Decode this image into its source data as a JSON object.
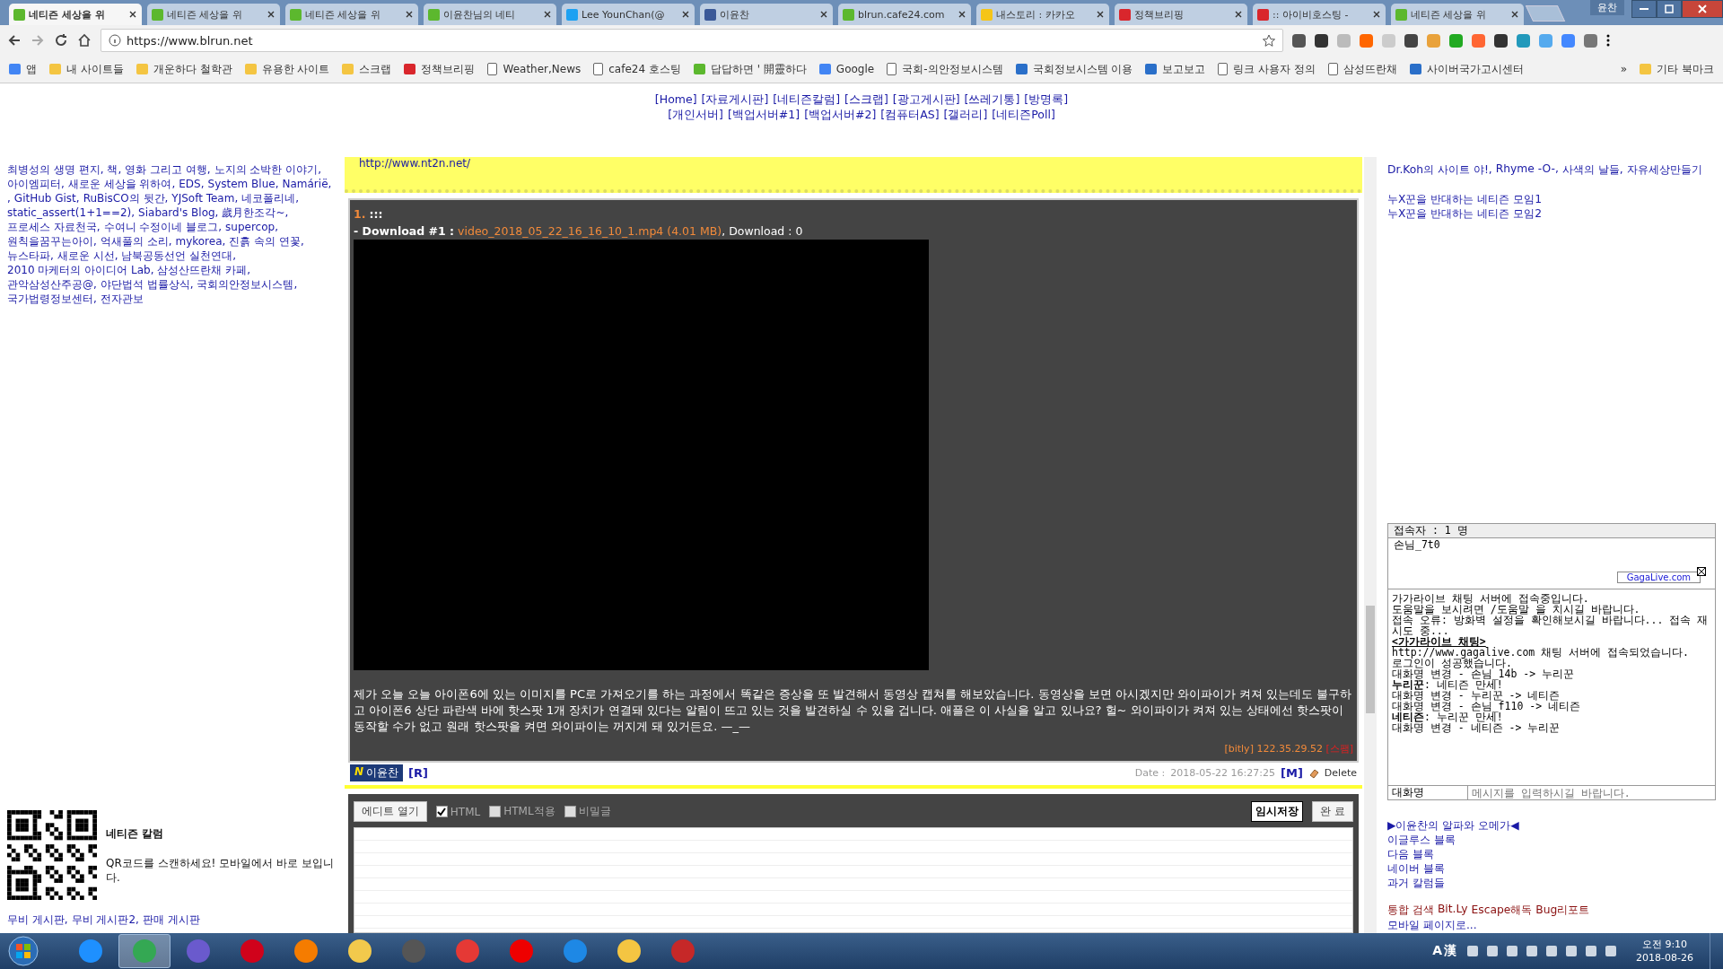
{
  "browser": {
    "user": "윤찬",
    "tabs": [
      {
        "label": "네티즌 세상을 위",
        "kind": "leaf",
        "selected": true
      },
      {
        "label": "네티즌 세상을 위",
        "kind": "leaf",
        "selected": false
      },
      {
        "label": "네티즌 세상을 위",
        "kind": "leaf",
        "selected": false
      },
      {
        "label": "이윤찬님의 네티",
        "kind": "leaf",
        "selected": false
      },
      {
        "label": "Lee YounChan(@",
        "kind": "bird",
        "selected": false
      },
      {
        "label": "이윤찬",
        "kind": "fb",
        "selected": false
      },
      {
        "label": "blrun.cafe24.com",
        "kind": "leaf",
        "selected": false
      },
      {
        "label": "내스토리 : 카카오",
        "kind": "note",
        "selected": false
      },
      {
        "label": "정책브리핑",
        "kind": "red",
        "selected": false
      },
      {
        "label": ":: 아이비호스팅 -",
        "kind": "red",
        "selected": false
      },
      {
        "label": "네티즌 세상을 위",
        "kind": "leaf",
        "selected": false
      }
    ],
    "url": "https://www.blrun.net",
    "bookmarks": [
      {
        "label": "앱",
        "kind": "apps"
      },
      {
        "label": "내 사이트들",
        "kind": "folder"
      },
      {
        "label": "개운하다 철학관",
        "kind": "folder"
      },
      {
        "label": "유용한 사이트",
        "kind": "folder"
      },
      {
        "label": "스크랩",
        "kind": "folder"
      },
      {
        "label": "정책브리핑",
        "kind": "red"
      },
      {
        "label": "Weather,News",
        "kind": "page"
      },
      {
        "label": "cafe24 호스팅",
        "kind": "page"
      },
      {
        "label": "답답하면 ' 開靈하다",
        "kind": "leaf"
      },
      {
        "label": "Google",
        "kind": "g"
      },
      {
        "label": "국회-의안정보시스템",
        "kind": "page"
      },
      {
        "label": "국회정보시스템 이용",
        "kind": "blue"
      },
      {
        "label": "보고보고",
        "kind": "blue"
      },
      {
        "label": "링크 사용자 정의",
        "kind": "page"
      },
      {
        "label": "삼성뜨란채",
        "kind": "page"
      },
      {
        "label": "사이버국가고시센터",
        "kind": "blue"
      }
    ],
    "more": "»",
    "other": "기타 북마크"
  },
  "nav": [
    [
      "[Home]",
      "[자료게시판]",
      "[네티즌칼럼]",
      "[스크랩]",
      "[광고게시판]",
      "[쓰레기통]",
      "[방명록]"
    ],
    [
      "[개인서버]",
      "[백업서버#1]",
      "[백업서버#2]",
      "[컴퓨터AS]",
      "[갤러리]",
      "[네티즌Poll]"
    ]
  ],
  "left": {
    "links": [
      "최병성의 생명 편지,",
      "책, 영화 그리고 여행,",
      "노지의 소박한 이야기,",
      "아이엠피터,",
      "새로운 세상을 위하여,",
      "EDS,",
      "System Blue,",
      "Namárië,",
      ",",
      "GitHub Gist,",
      "RuBisCO의 뒷간,",
      "YJSoft Team,",
      "네코폴리네,",
      "static_assert(1+1==2),",
      "Siabard's Blog,",
      "歲月한조각~,",
      "프로세스 자료천국,",
      "수여니 수정이네 블로그,",
      "supercop,",
      "원칙을꿈꾸는아이,",
      "억새풀의 소리,",
      "mykorea,",
      "진흙 속의 연꽃,",
      "뉴스타파,",
      "새로운 시선,",
      "남북공동선언 실천연대,",
      "2010 마케터의 아이디어 Lab,",
      "삼성산뜨란채 카페,",
      "관악삼성산주공@,",
      "야단법석 법률상식,",
      "국회의안정보시스템,",
      "국가법령정보센터,",
      "전자관보"
    ],
    "qr_title": "네티즌 칼럼",
    "qr_text": "QR코드를 스캔하세요! 모바일에서 바로 보입니다.",
    "boards": [
      "무비 게시판,",
      "무비 게시판2,",
      "판매 게시판"
    ]
  },
  "post": {
    "top_link": "http://www.nt2n.net/",
    "number": "1.",
    "title": ":::",
    "download_label": "- Download #1 :",
    "file": "video_2018_05_22_16_16_10_1.mp4 (4.01 MB)",
    "download_count": ", Download : 0",
    "body": "제가 오늘 오늘 아이폰6에 있는 이미지를 PC로 가져오기를 하는 과정에서 똑같은 증상을 또 발견해서 동영상 캡쳐를 해보았습니다. 동영상을 보면 아시겠지만 와이파이가 켜져 있는데도 불구하고 아이폰6 상단 파란색 바에 핫스팟 1개 장치가 연결돼 있다는 알림이 뜨고 있는 것을 발견하실 수 있을 겁니다. 애플은 이 사실을 알고 있나요? 헐~ 와이파이가 켜져 있는 상태에선 핫스팟이 동작할 수가 없고 원래 핫스팟을 켜면 와이파이는 꺼지게 돼 있거든요. —_—",
    "ip": "[bitly] 122.35.29.52",
    "spam": "[스팸]",
    "author_badge": "N",
    "author": "이윤찬",
    "reply": "[R]",
    "date_label": "Date :",
    "date": "2018-05-22 16:27:25",
    "modify": "[M]",
    "delete": "Delete"
  },
  "editor": {
    "open_button": "에디트 열기",
    "options": [
      {
        "label": "HTML",
        "checked": true
      },
      {
        "label": "HTML적용",
        "checked": false
      },
      {
        "label": "비밀글",
        "checked": false
      }
    ],
    "save_button": "임시저장",
    "done_button": "완 료"
  },
  "right": {
    "links": [
      "Dr.Koh의 사이트 야!,",
      "Rhyme -O-,",
      "사색의 날들,",
      "자유세상만들기"
    ],
    "groups": [
      "누X꾼을 반대하는 네티즌 모임1",
      "누X꾼을 반대하는 네티즌 모임2"
    ],
    "chat": {
      "users_header": "접속자 : 1 명",
      "users": [
        "손님_7t0"
      ],
      "brand": "GagaLive.com",
      "messages": [
        {
          "kind": "line",
          "text": "가가라이브 채팅 서버에 접속중입니다."
        },
        {
          "kind": "line",
          "text": "도움말을 보시려면 /도움말 을 치시길 바랍니다."
        },
        {
          "kind": "line",
          "text": "접속 오류: 방화벽 설정을 확인해보시길 바랍니다... 접속 재시도 중..."
        },
        {
          "kind": "header",
          "text": "<가가라이브 채팅>"
        },
        {
          "kind": "line",
          "text": "http://www.gagalive.com 채팅 서버에 접속되었습니다."
        },
        {
          "kind": "line",
          "text": "로그인이 성공했습니다."
        },
        {
          "kind": "line",
          "text": "대화명 변경 - 손님_14b -> 누리꾼"
        },
        {
          "kind": "line",
          "text": "**누리꾼**: 네티즌 만세!"
        },
        {
          "kind": "line",
          "text": "대화명 변경 - 누리꾼 -> 네티즌"
        },
        {
          "kind": "line",
          "text": "대화명 변경 - 손님_f110 -> 네티즌"
        },
        {
          "kind": "line",
          "text": "**네티즌**: 누리꾼 만세!"
        },
        {
          "kind": "line",
          "text": "대화명 변경 - 네티즌 -> 누리꾼"
        }
      ],
      "nick": "대화명",
      "placeholder": "메시지를 입력하시길 바랍니다."
    },
    "blogs": [
      "▶이윤찬의 알파와 오메가◀",
      "이글루스 블록",
      "다음 블록",
      "네이버 블록",
      "과거 칼럼들"
    ],
    "tools": [
      "통합 검색",
      "Bit.Ly",
      "Escape해독",
      "Bug리포트"
    ],
    "mobile": "모바일 페이지로..."
  },
  "taskbar": {
    "apps": [
      {
        "kind": "ie",
        "selected": false
      },
      {
        "kind": "chrome",
        "selected": true
      },
      {
        "kind": "orb",
        "selected": false
      },
      {
        "kind": "opera",
        "selected": false
      },
      {
        "kind": "firefox",
        "selected": false
      },
      {
        "kind": "winamp",
        "selected": false
      },
      {
        "kind": "drive",
        "selected": false
      },
      {
        "kind": "disc",
        "selected": false
      },
      {
        "kind": "record",
        "selected": false
      },
      {
        "kind": "tree",
        "selected": false
      },
      {
        "kind": "folder",
        "selected": false
      },
      {
        "kind": "ftp",
        "selected": false
      }
    ],
    "ime": [
      "A",
      "漢"
    ],
    "time": "오전 9:10",
    "date": "2018-08-26"
  }
}
